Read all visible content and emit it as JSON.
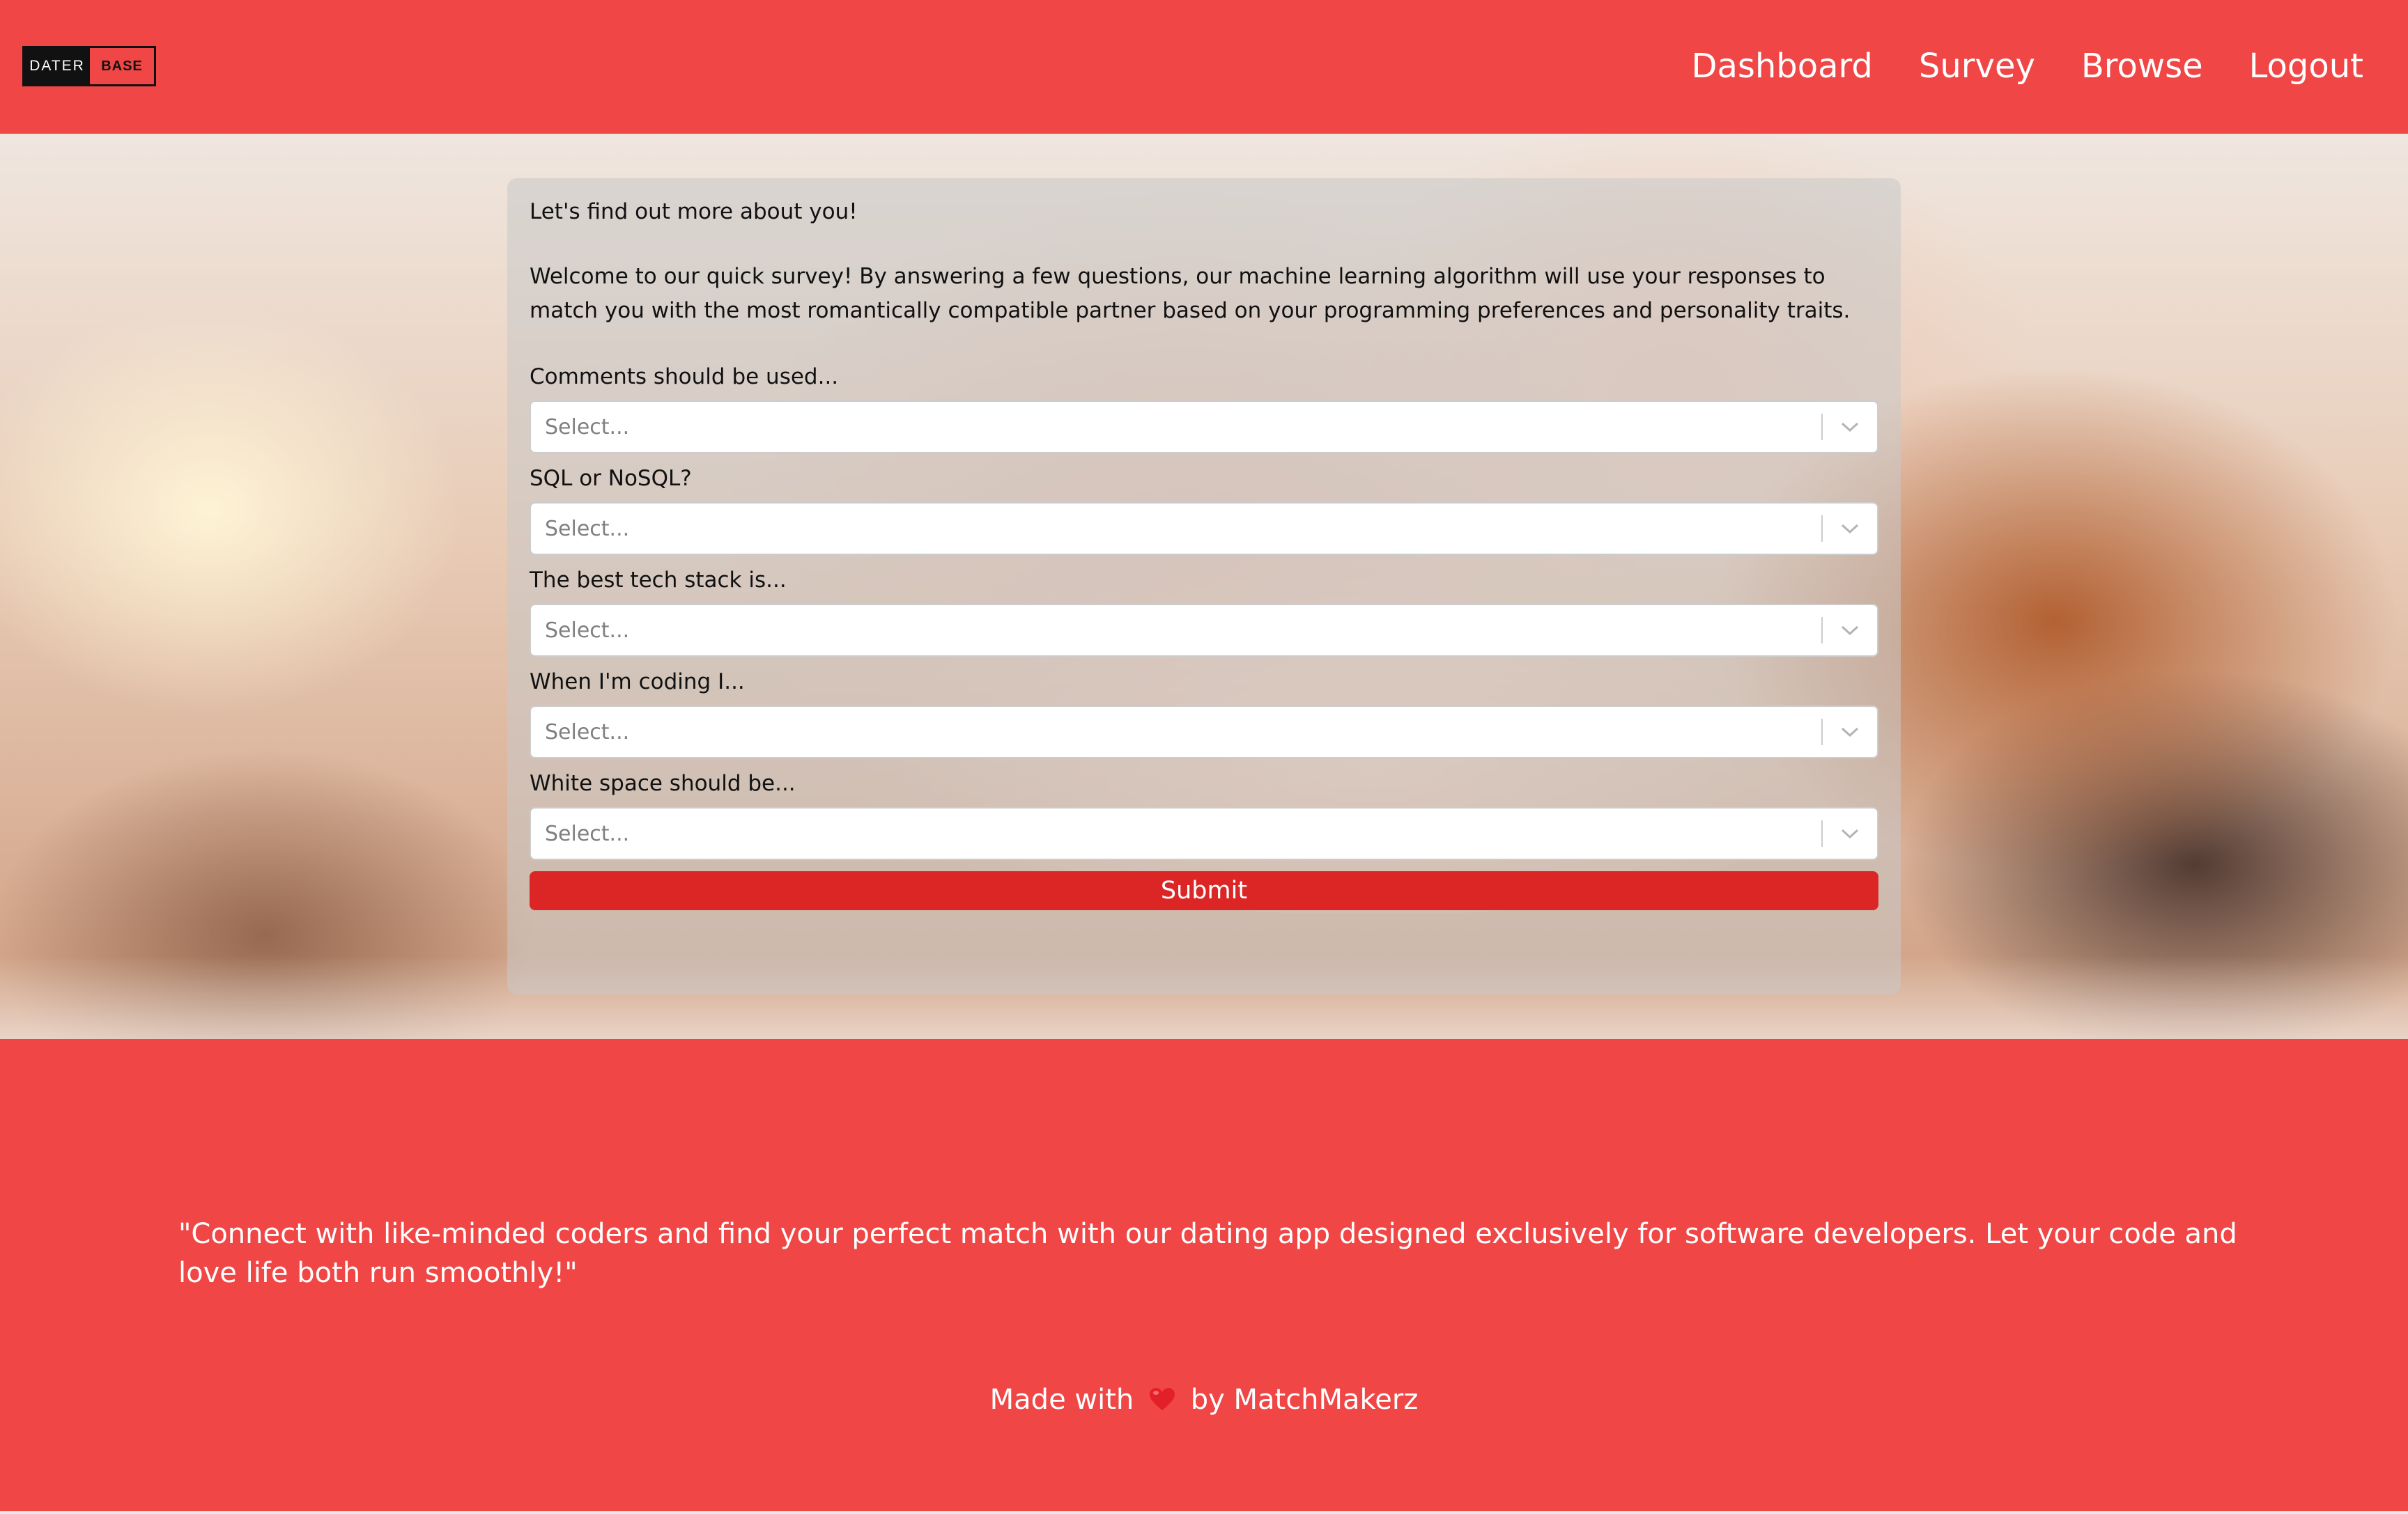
{
  "header": {
    "logo": {
      "left": "DATER",
      "right": "BASE"
    },
    "nav": [
      {
        "label": "Dashboard"
      },
      {
        "label": "Survey"
      },
      {
        "label": "Browse"
      },
      {
        "label": "Logout"
      }
    ]
  },
  "survey": {
    "heading": "Let's find out more about you!",
    "intro": "Welcome to our quick survey! By answering a few questions, our machine learning algorithm will use your responses to match you with the most romantically compatible partner based on your programming preferences and personality traits.",
    "questions": [
      {
        "label": "Comments should be used...",
        "placeholder": "Select..."
      },
      {
        "label": "SQL or NoSQL?",
        "placeholder": "Select..."
      },
      {
        "label": "The best tech stack is...",
        "placeholder": "Select..."
      },
      {
        "label": "When I'm coding I...",
        "placeholder": "Select..."
      },
      {
        "label": "White space should be...",
        "placeholder": "Select..."
      }
    ],
    "submit_label": "Submit"
  },
  "footer": {
    "tagline": "\"Connect with like-minded coders and find your perfect match with our dating app designed exclusively for software developers. Let your code and love life both run smoothly!\"",
    "made_with_prefix": "Made with",
    "made_with_suffix": "by MatchMakerz"
  },
  "colors": {
    "brand": "#f04646",
    "submit": "#dc2626",
    "heart": "#e3202a"
  },
  "icons": {
    "select_indicator": "chevron-down-icon",
    "heart": "heart-icon"
  }
}
